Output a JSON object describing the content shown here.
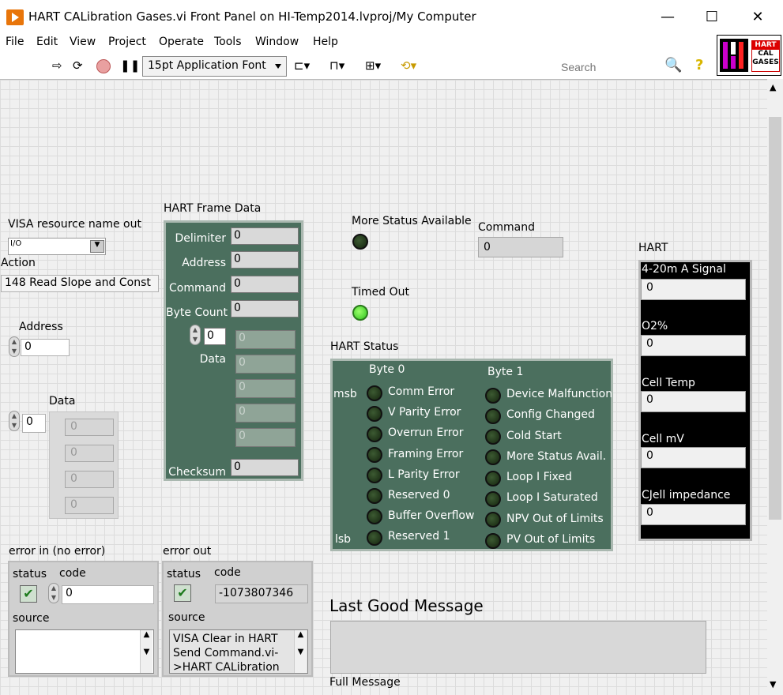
{
  "window": {
    "title": "HART CALibration Gases.vi Front Panel on HI-Temp2014.lvproj/My Computer",
    "minimize": "—",
    "maximize": "☐",
    "close": "✕"
  },
  "menu": [
    "File",
    "Edit",
    "View",
    "Project",
    "Operate",
    "Tools",
    "Window",
    "Help"
  ],
  "toolbar": {
    "font": "15pt Application Font",
    "search_placeholder": "Search"
  },
  "logo": {
    "line1": "HART",
    "line2": "CAL",
    "line3": "GASES"
  },
  "visa": {
    "label": "VISA resource name out",
    "icon": "I/O"
  },
  "action": {
    "label": "Action",
    "value": "148 Read Slope and Const"
  },
  "address": {
    "label": "Address",
    "value": "0"
  },
  "data": {
    "label": "Data",
    "index": "0",
    "values": [
      "0",
      "0",
      "0",
      "0"
    ]
  },
  "frame": {
    "title": "HART Frame Data",
    "delimiter_label": "Delimiter",
    "delimiter": "0",
    "address_label": "Address",
    "address": "0",
    "command_label": "Command",
    "command": "0",
    "bytecount_label": "Byte Count",
    "bytecount": "0",
    "data_label": "Data",
    "data_index": "0",
    "data_values": [
      "0",
      "0",
      "0",
      "0",
      "0"
    ],
    "checksum_label": "Checksum",
    "checksum": "0"
  },
  "more_status": {
    "label": "More Status Available"
  },
  "timed_out": {
    "label": "Timed Out"
  },
  "command": {
    "label": "Command",
    "value": "0"
  },
  "hart_status": {
    "title": "HART Status",
    "byte0": "Byte 0",
    "byte1": "Byte 1",
    "msb": "msb",
    "lsb": "lsb",
    "byte0_items": [
      "Comm Error",
      "V Parity Error",
      "Overrun Error",
      "Framing Error",
      "L Parity Error",
      "Reserved 0",
      "Buffer Overflow",
      "Reserved 1"
    ],
    "byte1_items": [
      "Device Malfunction",
      "Config Changed",
      "Cold Start",
      "More Status Avail.",
      "Loop I Fixed",
      "Loop I Saturated",
      "NPV Out of Limits",
      "PV Out of Limits"
    ]
  },
  "hart": {
    "title": "HART",
    "signal_label": "4-20m A Signal",
    "signal": "0",
    "o2_label": "O2%",
    "o2": "0",
    "celltemp_label": "Cell Temp",
    "celltemp": "0",
    "cellmv_label": "Cell mV",
    "cellmv": "0",
    "impedance_label": "CJell impedance",
    "impedance": "0"
  },
  "error_in": {
    "title": "error in (no error)",
    "status_label": "status",
    "code_label": "code",
    "code": "0",
    "source_label": "source",
    "source": ""
  },
  "error_out": {
    "title": "error out",
    "status_label": "status",
    "code_label": "code",
    "code": "-1073807346",
    "source_label": "source",
    "source": "VISA Clear in HART Send Command.vi->HART CALibration"
  },
  "last_good": {
    "label": "Last Good Message",
    "value": ""
  },
  "full_message": {
    "label": "Full Message"
  },
  "colors": {
    "panel_green": "#4b6f5e",
    "led_on": "#2fc31e",
    "led_off": "#1b2e14",
    "accent": "#e8750a"
  }
}
